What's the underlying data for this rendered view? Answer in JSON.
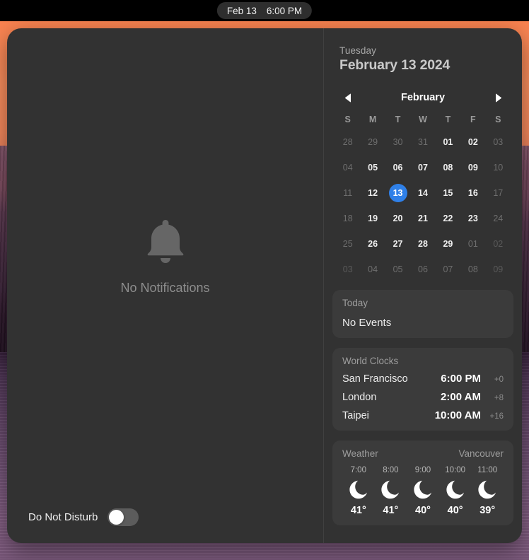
{
  "menubar": {
    "clock_date": "Feb 13",
    "clock_time": "6:00 PM"
  },
  "notifications": {
    "icon": "bell-icon",
    "empty_label": "No Notifications",
    "dnd_label": "Do Not Disturb",
    "dnd_enabled": false
  },
  "date_header": {
    "weekday": "Tuesday",
    "full_date": "February 13 2024"
  },
  "calendar": {
    "prev_icon": "chevron-left-icon",
    "next_icon": "chevron-right-icon",
    "month": "February",
    "day_initials": [
      "S",
      "M",
      "T",
      "W",
      "T",
      "F",
      "S"
    ],
    "selected_day": "13",
    "selected_color": "#2f80e8",
    "weeks": [
      [
        {
          "d": "28",
          "s": "dim"
        },
        {
          "d": "29",
          "s": "dim"
        },
        {
          "d": "30",
          "s": "dim"
        },
        {
          "d": "31",
          "s": "dim"
        },
        {
          "d": "01",
          "s": "on"
        },
        {
          "d": "02",
          "s": "on"
        },
        {
          "d": "03",
          "s": "dim"
        }
      ],
      [
        {
          "d": "04",
          "s": "dim"
        },
        {
          "d": "05",
          "s": "on"
        },
        {
          "d": "06",
          "s": "on"
        },
        {
          "d": "07",
          "s": "on"
        },
        {
          "d": "08",
          "s": "on"
        },
        {
          "d": "09",
          "s": "on"
        },
        {
          "d": "10",
          "s": "dim"
        }
      ],
      [
        {
          "d": "11",
          "s": "dim"
        },
        {
          "d": "12",
          "s": "on"
        },
        {
          "d": "13",
          "s": "sel"
        },
        {
          "d": "14",
          "s": "on"
        },
        {
          "d": "15",
          "s": "on"
        },
        {
          "d": "16",
          "s": "on"
        },
        {
          "d": "17",
          "s": "dim"
        }
      ],
      [
        {
          "d": "18",
          "s": "dim"
        },
        {
          "d": "19",
          "s": "on"
        },
        {
          "d": "20",
          "s": "on"
        },
        {
          "d": "21",
          "s": "on"
        },
        {
          "d": "22",
          "s": "on"
        },
        {
          "d": "23",
          "s": "on"
        },
        {
          "d": "24",
          "s": "dim"
        }
      ],
      [
        {
          "d": "25",
          "s": "dim"
        },
        {
          "d": "26",
          "s": "on"
        },
        {
          "d": "27",
          "s": "on"
        },
        {
          "d": "28",
          "s": "on"
        },
        {
          "d": "29",
          "s": "on"
        },
        {
          "d": "01",
          "s": "dim"
        },
        {
          "d": "02",
          "s": "dim2"
        }
      ],
      [
        {
          "d": "03",
          "s": "dim2"
        },
        {
          "d": "04",
          "s": "dim"
        },
        {
          "d": "05",
          "s": "dim"
        },
        {
          "d": "06",
          "s": "dim"
        },
        {
          "d": "07",
          "s": "dim"
        },
        {
          "d": "08",
          "s": "dim"
        },
        {
          "d": "09",
          "s": "dim2"
        }
      ]
    ]
  },
  "events_card": {
    "title": "Today",
    "body": "No Events"
  },
  "world_clocks": {
    "title": "World Clocks",
    "rows": [
      {
        "city": "San Francisco",
        "time": "6:00 PM",
        "offset": "+0"
      },
      {
        "city": "London",
        "time": "2:00 AM",
        "offset": "+8"
      },
      {
        "city": "Taipei",
        "time": "10:00 AM",
        "offset": "+16"
      }
    ]
  },
  "weather": {
    "title": "Weather",
    "city": "Vancouver",
    "hours": [
      {
        "time": "7:00",
        "icon": "crescent-moon-icon",
        "temp": "41°"
      },
      {
        "time": "8:00",
        "icon": "crescent-moon-icon",
        "temp": "41°"
      },
      {
        "time": "9:00",
        "icon": "crescent-moon-icon",
        "temp": "40°"
      },
      {
        "time": "10:00",
        "icon": "crescent-moon-icon",
        "temp": "40°"
      },
      {
        "time": "11:00",
        "icon": "crescent-moon-icon",
        "temp": "39°"
      }
    ]
  }
}
